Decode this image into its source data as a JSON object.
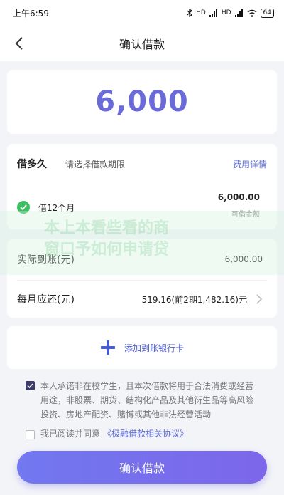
{
  "status_bar": {
    "time": "上午6:59",
    "signal_1": "HD",
    "signal_2": "HD",
    "battery": "64"
  },
  "nav": {
    "title": "确认借款"
  },
  "amount": {
    "value": "6,000"
  },
  "term": {
    "title": "借多久",
    "placeholder": "请选择借款期限",
    "detail_link": "费用详情",
    "option": "借12个月",
    "amount": "6,000.00",
    "amount_label": "可借金额"
  },
  "info": {
    "received_label": "实际到账(元)",
    "received_value": "6,000.00",
    "monthly_label": "每月应还(元)",
    "monthly_value": "519.16(前2期1,482.16)元"
  },
  "watermark": {
    "line1": "本上本看些看的商",
    "line2": "窗口予如何申请贷"
  },
  "bank": {
    "label": "添加到账银行卡"
  },
  "agreement": {
    "text": "本人承诺非在校学生，且本次借款将用于合法消费或经营用途，非股票、期货、结构化产品及其他衍生品等高风险投资、房地产配资、赌博或其他非法经营活动",
    "protocol_prefix": "我已阅读并同意",
    "protocol_link": "《极融借款相关协议》"
  },
  "confirm_button": {
    "label": "确认借款"
  },
  "colors": {
    "accent": "#6a6ad8",
    "link": "#5b6bd6",
    "check_green": "#3cbf63",
    "button_start": "#7178f0",
    "button_end": "#7d66ea"
  }
}
